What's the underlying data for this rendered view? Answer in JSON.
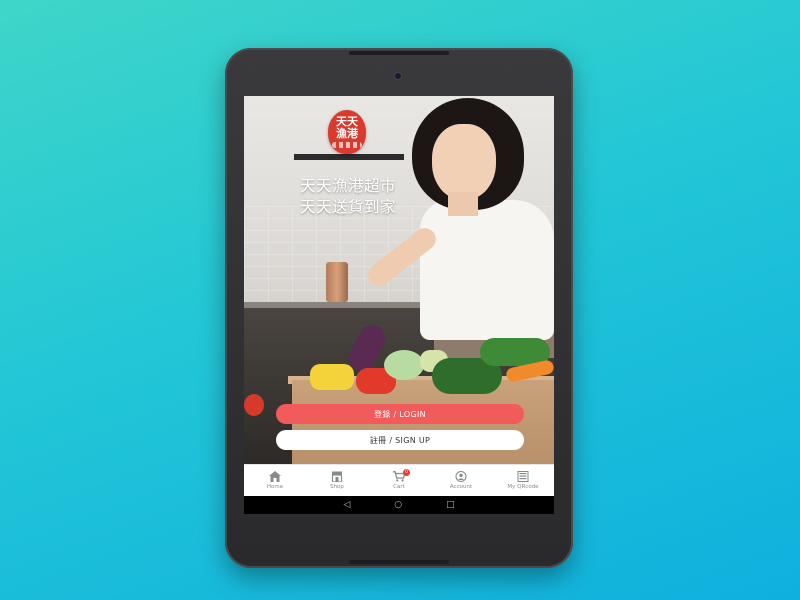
{
  "app": {
    "logo_text_line1": "天天",
    "logo_text_line2": "漁港",
    "slogan_line1": "天天漁港超市",
    "slogan_line2": "天天送貨到家"
  },
  "auth": {
    "login_label": "登錄 / LOGIN",
    "signup_label": "註冊 / SIGN UP"
  },
  "tabbar": {
    "items": [
      {
        "label": "Home",
        "icon": "home-icon"
      },
      {
        "label": "Shop",
        "icon": "shop-icon"
      },
      {
        "label": "Cart",
        "icon": "cart-icon",
        "badge": "0"
      },
      {
        "label": "Account",
        "icon": "account-icon"
      },
      {
        "label": "My QRcode",
        "icon": "qrcode-icon"
      }
    ]
  },
  "system_nav": {
    "back_glyph": "◁",
    "home_glyph": "○",
    "recents_glyph": "□"
  },
  "colors": {
    "accent": "#f25b5b",
    "background_start": "#3fd6c9",
    "background_end": "#0fb0de",
    "logo_red": "#d93a2e"
  }
}
